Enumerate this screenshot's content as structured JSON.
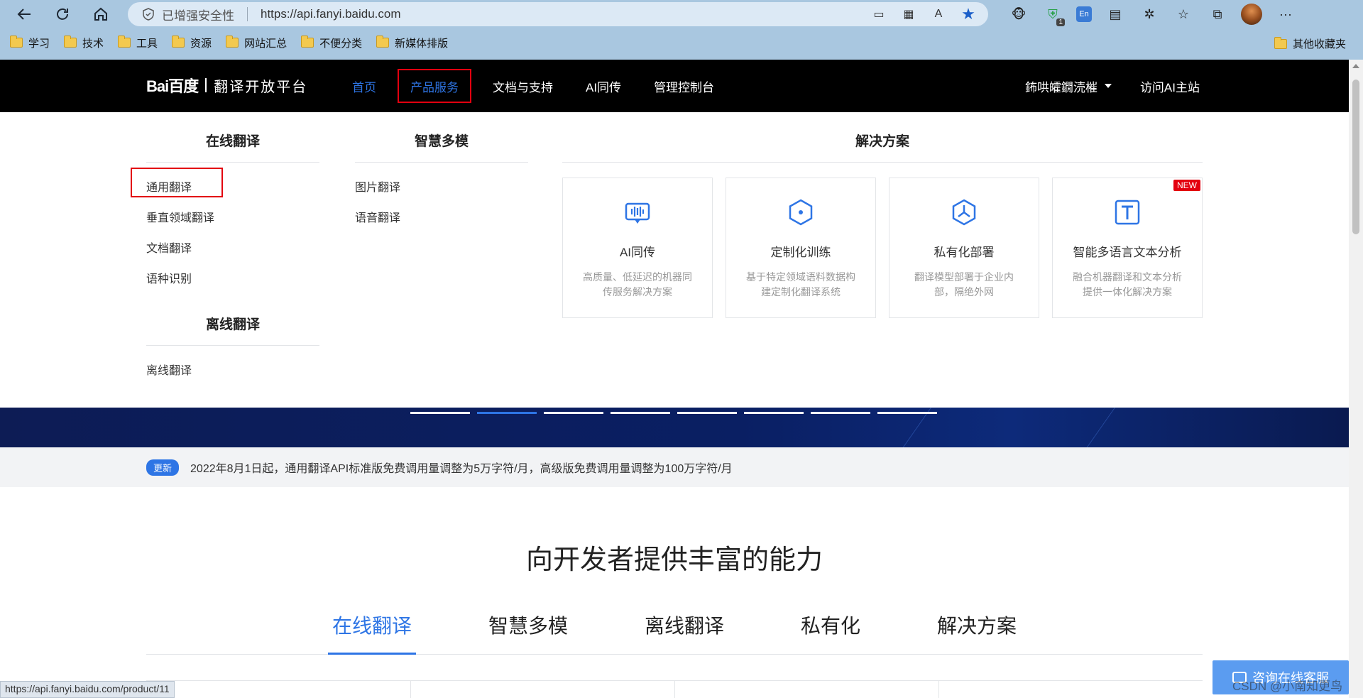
{
  "browser": {
    "secure_label": "已增强安全性",
    "url": "https://api.fanyi.baidu.com",
    "bookmarks": [
      "学习",
      "技术",
      "工具",
      "资源",
      "网站汇总",
      "不便分类",
      "新媒体排版"
    ],
    "other_bookmarks": "其他收藏夹",
    "ext_badge": "1",
    "ext_translate": "En"
  },
  "header": {
    "logo": "Bai百度",
    "platform": "翻译开放平台",
    "nav": [
      "首页",
      "产品服务",
      "文档与支持",
      "AI同传",
      "管理控制台"
    ],
    "user": "鈽哄皬鐗涜槯",
    "visit_ai": "访问AI主站"
  },
  "menu": {
    "online_title": "在线翻译",
    "online_items": [
      "通用翻译",
      "垂直领域翻译",
      "文档翻译",
      "语种识别"
    ],
    "offline_title": "离线翻译",
    "offline_items": [
      "离线翻译"
    ],
    "multimodal_title": "智慧多模",
    "multimodal_items": [
      "图片翻译",
      "语音翻译"
    ],
    "solutions_title": "解决方案",
    "cards": [
      {
        "title": "AI同传",
        "desc": "高质量、低延迟的机器同传服务解决方案",
        "icon": "ai-interpretation-icon"
      },
      {
        "title": "定制化训练",
        "desc": "基于特定领域语料数据构建定制化翻译系统",
        "icon": "custom-training-icon"
      },
      {
        "title": "私有化部署",
        "desc": "翻译模型部署于企业内部，隔绝外网",
        "icon": "private-deploy-icon"
      },
      {
        "title": "智能多语言文本分析",
        "desc": "融合机器翻译和文本分析提供一体化解决方案",
        "icon": "text-analysis-icon",
        "badge": "NEW"
      }
    ]
  },
  "notice": {
    "tag": "更新",
    "text": "2022年8月1日起，通用翻译API标准版免费调用量调整为5万字符/月，高级版免费调用量调整为100万字符/月"
  },
  "capability": {
    "title": "向开发者提供丰富的能力",
    "tabs": [
      "在线翻译",
      "智慧多模",
      "离线翻译",
      "私有化",
      "解决方案"
    ]
  },
  "status_url": "https://api.fanyi.baidu.com/product/11",
  "consult": "咨询在线客服",
  "watermark": "CSDN @小南知更鸟",
  "colors": {
    "accent": "#2e75e5",
    "highlight_box": "#e3000f",
    "header_bg": "#000000"
  }
}
